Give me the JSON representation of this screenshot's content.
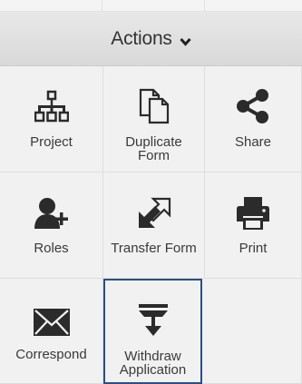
{
  "menu": {
    "title": "Actions",
    "title_icon": "chevron-down-icon",
    "items": [
      {
        "label": "Project",
        "icon": "org-chart-icon"
      },
      {
        "label": "Duplicate\nForm",
        "icon": "duplicate-icon"
      },
      {
        "label": "Share",
        "icon": "share-icon"
      },
      {
        "label": "Roles",
        "icon": "add-user-icon"
      },
      {
        "label": "Transfer Form",
        "icon": "transfer-icon"
      },
      {
        "label": "Print",
        "icon": "printer-icon"
      },
      {
        "label": "Correspond",
        "icon": "envelope-icon"
      },
      {
        "label": "Withdraw\nApplication",
        "icon": "withdraw-icon",
        "selected": true
      }
    ]
  },
  "colors": {
    "tile_bg": "#f1f1f1",
    "header_bg": "#dfdfdf",
    "icon": "#2b2b2b",
    "selected_border": "#2a4f82"
  }
}
